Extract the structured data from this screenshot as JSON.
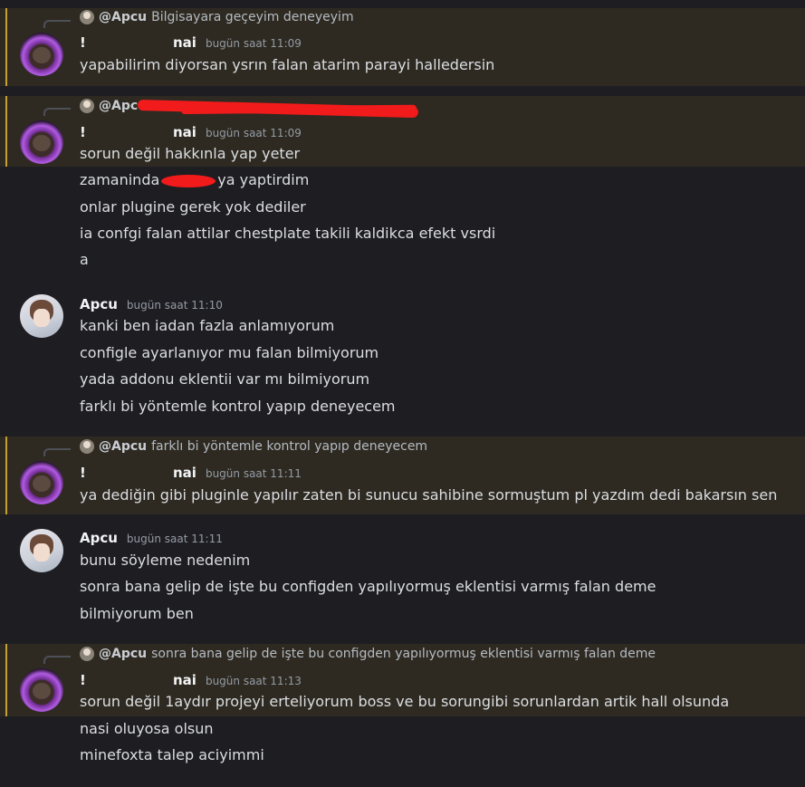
{
  "messages": [
    {
      "reply": {
        "author": "@Apcu",
        "text": "Bilgisayara geçeyim deneyeyim"
      },
      "bang": "!",
      "author": "nai",
      "time": "bugün saat 11:09",
      "lines": [
        "yapabilirim diyorsan ysrın falan atarim parayi halledersin"
      ]
    },
    {
      "reply": {
        "author": "@Apcu",
        "text": ""
      },
      "bang": "!",
      "author": "nai",
      "time": "bugün saat 11:09",
      "lines": [
        "sorun değil hakkınla yap yeter",
        "zamaninda",
        "ya yaptirdim",
        "onlar plugine gerek yok dediler",
        "ia confgi falan attilar chestplate takili kaldikca efekt vsrdi",
        "a"
      ]
    },
    {
      "author": "Apcu",
      "time": "bugün saat 11:10",
      "lines": [
        "kanki ben iadan fazla anlamıyorum",
        "configle ayarlanıyor mu falan bilmiyorum",
        "yada addonu eklentii var mı bilmiyorum",
        "farklı bi yöntemle kontrol yapıp deneyecem"
      ]
    },
    {
      "reply": {
        "author": "@Apcu",
        "text": "farklı bi yöntemle kontrol yapıp deneyecem"
      },
      "bang": "!",
      "author": "nai",
      "time": "bugün saat 11:11",
      "lines": [
        "ya dediğin gibi pluginle yapılır zaten bi sunucu sahibine sormuştum pl yazdım dedi bakarsın sen"
      ]
    },
    {
      "author": "Apcu",
      "time": "bugün saat 11:11",
      "lines": [
        "bunu söyleme nedenim",
        "sonra bana gelip de işte bu configden yapılıyormuş eklentisi varmış falan deme",
        "bilmiyorum ben"
      ]
    },
    {
      "reply": {
        "author": "@Apcu",
        "text": "sonra bana gelip de işte bu configden yapılıyormuş eklentisi varmış falan deme"
      },
      "bang": "!",
      "author": "nai",
      "time": "bugün saat 11:13",
      "lines": [
        "sorun değil 1aydır projeyi erteliyorum boss ve bu sorungibi sorunlardan artik hall olsunda",
        "nasi oluyosa olsun",
        "minefoxta talep aciyimmi"
      ]
    }
  ]
}
